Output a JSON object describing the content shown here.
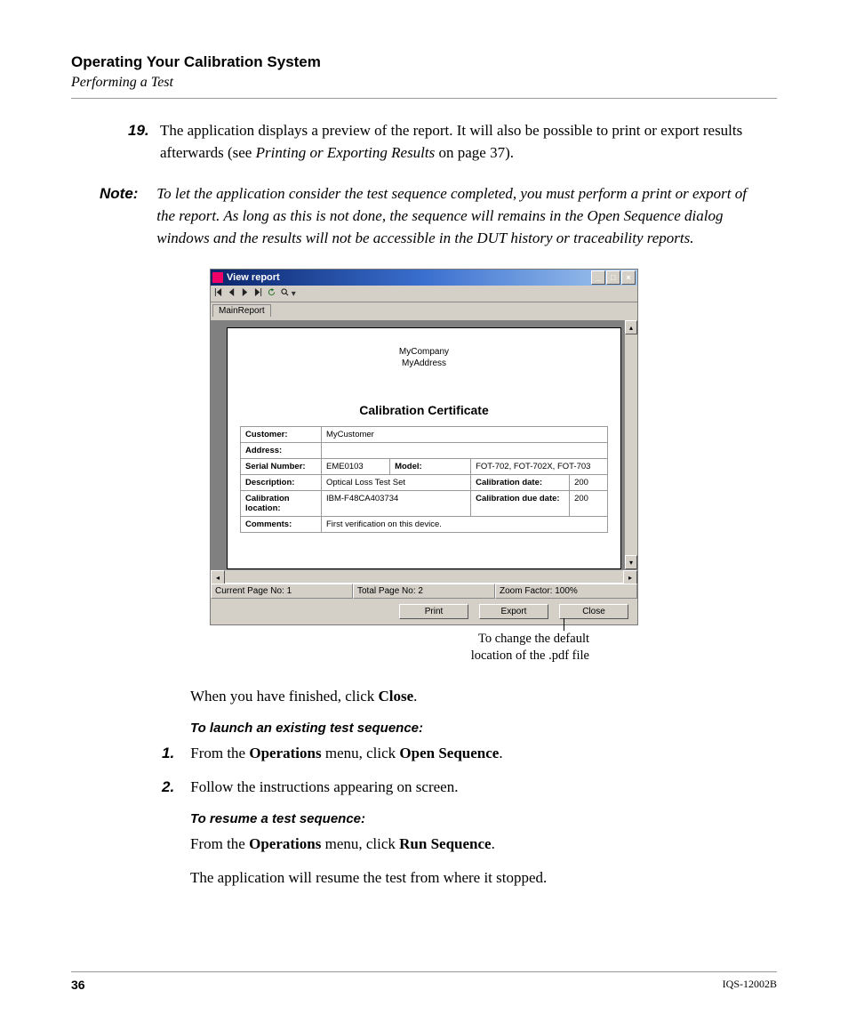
{
  "header": {
    "title": "Operating Your Calibration System",
    "subtitle": "Performing a Test"
  },
  "step19": {
    "num": "19.",
    "text_a": "The application displays a preview of the report. It will also be possible to print or export results afterwards (see ",
    "text_b": "Printing or Exporting Results",
    "text_c": " on page 37)."
  },
  "note": {
    "label": "Note:",
    "text": "To let the application consider the test sequence completed, you must perform a print or export of the report. As long as this is not done, the sequence will remains in the Open Sequence dialog windows and the results will not be accessible in the DUT history or traceability reports."
  },
  "window": {
    "title": "View report",
    "tab": "MainReport",
    "company": "MyCompany",
    "address": "MyAddress",
    "cert_title": "Calibration Certificate",
    "fields": {
      "customer_k": "Customer:",
      "customer_v": "MyCustomer",
      "address_k": "Address:",
      "address_v": "",
      "serial_k": "Serial Number:",
      "serial_v": "EME0103",
      "model_k": "Model:",
      "model_v": "FOT-702, FOT-702X, FOT-703",
      "desc_k": "Description:",
      "desc_v": "Optical Loss Test Set",
      "caldate_k": "Calibration date:",
      "caldate_v": "200",
      "calloc_k": "Calibration location:",
      "calloc_v": "IBM-F48CA403734",
      "caldue_k": "Calibration due date:",
      "caldue_v": "200",
      "comments_k": "Comments:",
      "comments_v": "First verification on this device."
    },
    "status": {
      "current": "Current Page No: 1",
      "total": "Total Page No: 2",
      "zoom": "Zoom Factor: 100%"
    },
    "buttons": {
      "print": "Print",
      "export": "Export",
      "close": "Close"
    }
  },
  "callout": {
    "l1": "To change the default",
    "l2": "location of the .pdf file"
  },
  "after_close": {
    "a": "When you have finished, click ",
    "b": "Close",
    "c": "."
  },
  "launch": {
    "heading": "To launch an existing test sequence:",
    "s1": {
      "num": "1.",
      "a": "From the ",
      "b": "Operations",
      "c": " menu, click ",
      "d": "Open Sequence",
      "e": "."
    },
    "s2": {
      "num": "2.",
      "text": "Follow the instructions appearing on screen."
    }
  },
  "resume": {
    "heading": "To resume a test sequence:",
    "l1": {
      "a": "From the ",
      "b": "Operations",
      "c": " menu, click ",
      "d": "Run Sequence",
      "e": "."
    },
    "l2": "The application will resume the test from where it stopped."
  },
  "footer": {
    "page": "36",
    "doc": "IQS-12002B"
  }
}
